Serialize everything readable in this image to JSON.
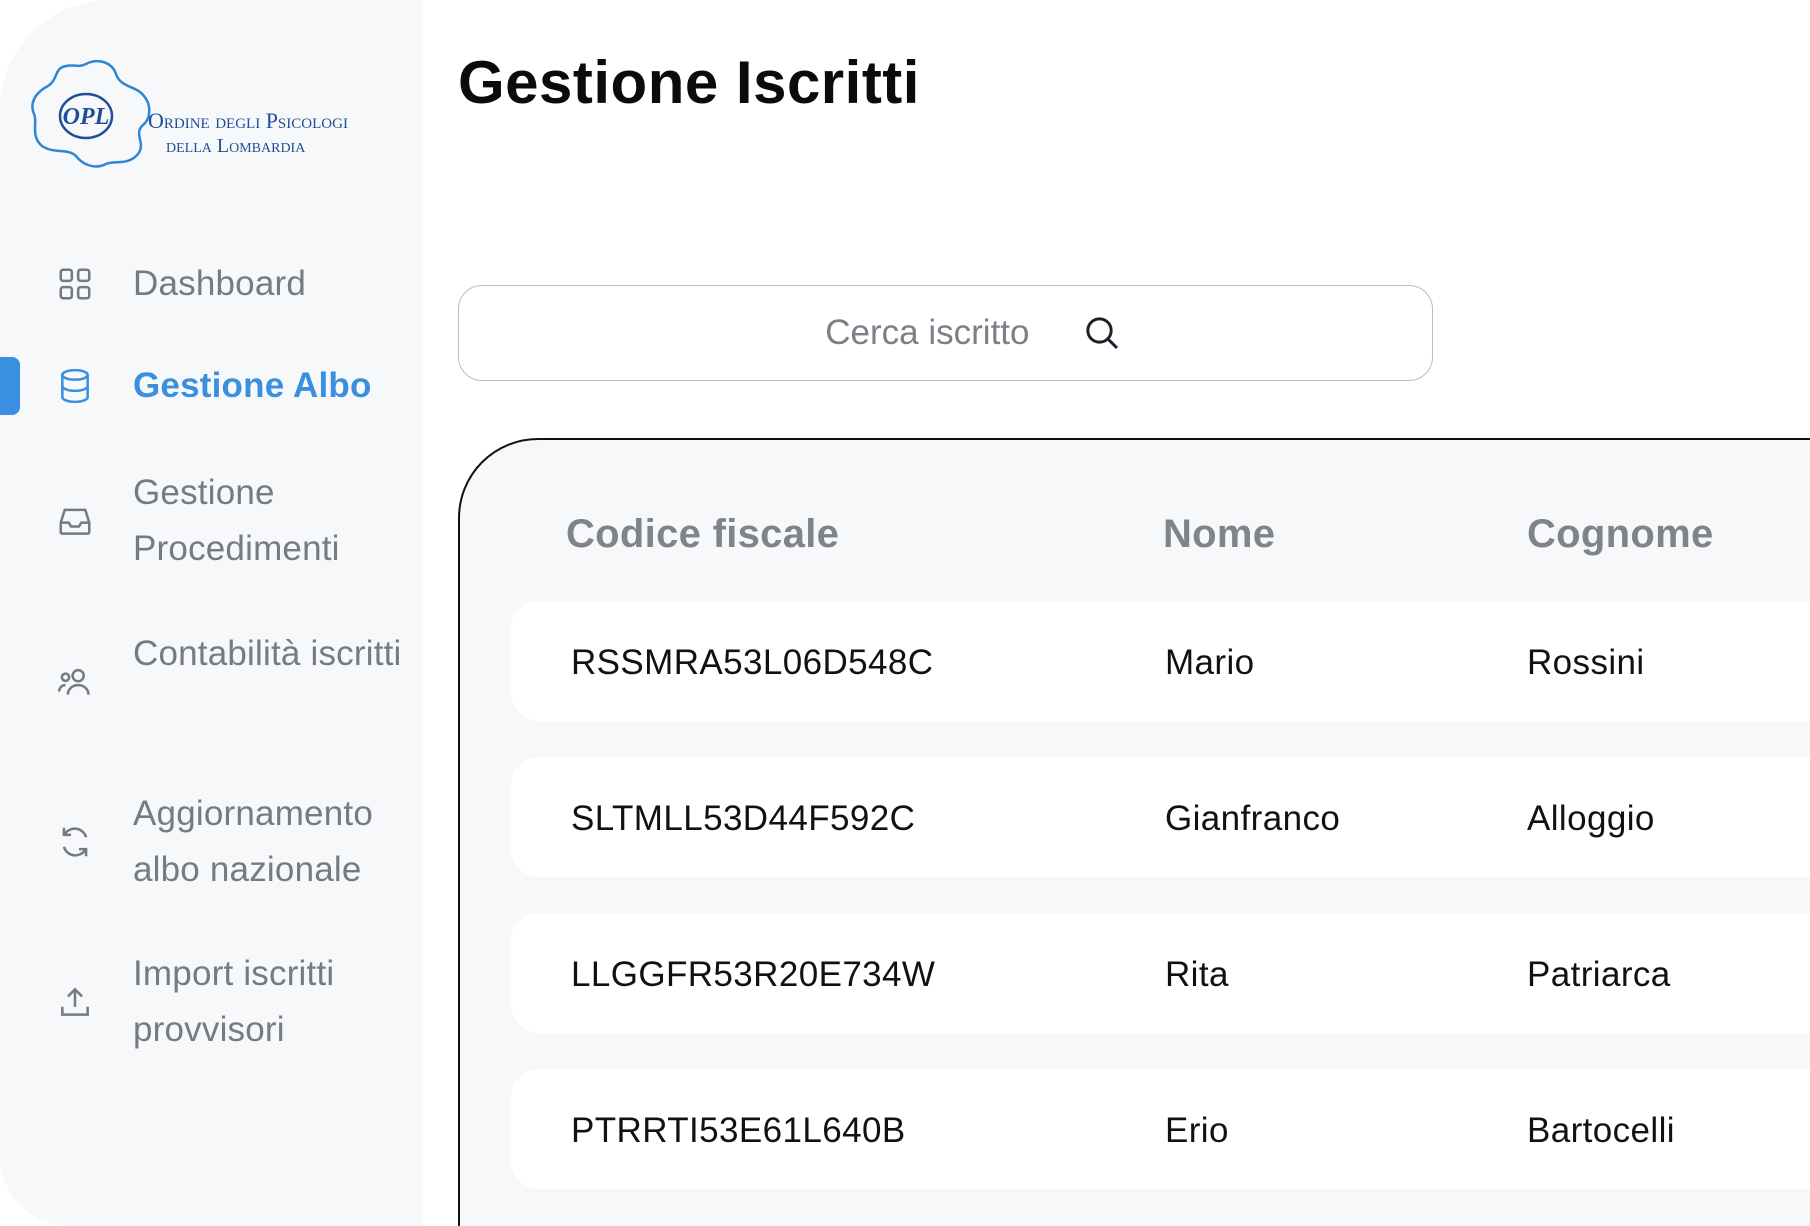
{
  "brand": {
    "monogram": "OPL",
    "line1": "Ordine degli Psicologi",
    "line2": "della Lombardia",
    "color": "#1f4f9a"
  },
  "sidebar": {
    "items": [
      {
        "label": "Dashboard",
        "icon": "grid-icon",
        "active": false
      },
      {
        "label": "Gestione Albo",
        "icon": "database-icon",
        "active": true
      },
      {
        "label": "Gestione Procedimenti",
        "icon": "inbox-icon",
        "active": false
      },
      {
        "label": "Contabilità iscritti",
        "icon": "users-icon",
        "active": false
      },
      {
        "label": "Aggiornamento albo nazionale",
        "icon": "refresh-icon",
        "active": false
      },
      {
        "label": "Import iscritti provvisori",
        "icon": "upload-icon",
        "active": false
      }
    ]
  },
  "main": {
    "title": "Gestione Iscritti",
    "search": {
      "placeholder": "Cerca iscritto",
      "value": ""
    },
    "table": {
      "columns": [
        "Codice fiscale",
        "Nome",
        "Cognome"
      ],
      "rows": [
        [
          "RSSMRA53L06D548C",
          "Mario",
          "Rossini"
        ],
        [
          "SLTMLL53D44F592C",
          "Gianfranco",
          "Alloggio"
        ],
        [
          "LLGGFR53R20E734W",
          "Rita",
          "Patriarca"
        ],
        [
          "PTRRTI53E61L640B",
          "Erio",
          "Bartocelli"
        ]
      ]
    }
  },
  "colors": {
    "accent": "#3a8fe0",
    "sidebar_bg": "#f7f8fa",
    "muted_text": "#757b84"
  }
}
